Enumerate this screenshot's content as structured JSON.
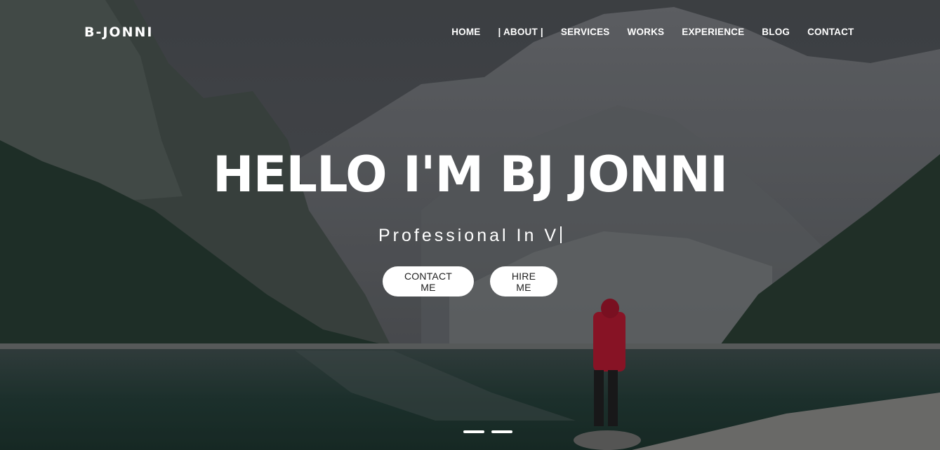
{
  "brand": {
    "name": "B-JONNI"
  },
  "nav": {
    "items": [
      {
        "label": "HOME"
      },
      {
        "label": "| ABOUT |"
      },
      {
        "label": "SERVICES"
      },
      {
        "label": "WORKS"
      },
      {
        "label": "EXPERIENCE"
      },
      {
        "label": "BLOG"
      },
      {
        "label": "CONTACT"
      }
    ]
  },
  "hero": {
    "title": "HELLO I'M BJ JONNI",
    "subtitle": "Professional In V",
    "buttons": {
      "contact_label": "CONTACT ME",
      "hire_label": "HIRE ME"
    },
    "slider_dots": 2,
    "background_image": "mountain-lake-landscape-photo"
  },
  "colors": {
    "text": "#ffffff",
    "button_bg": "#ffffff",
    "button_text": "#1d1d1d"
  }
}
